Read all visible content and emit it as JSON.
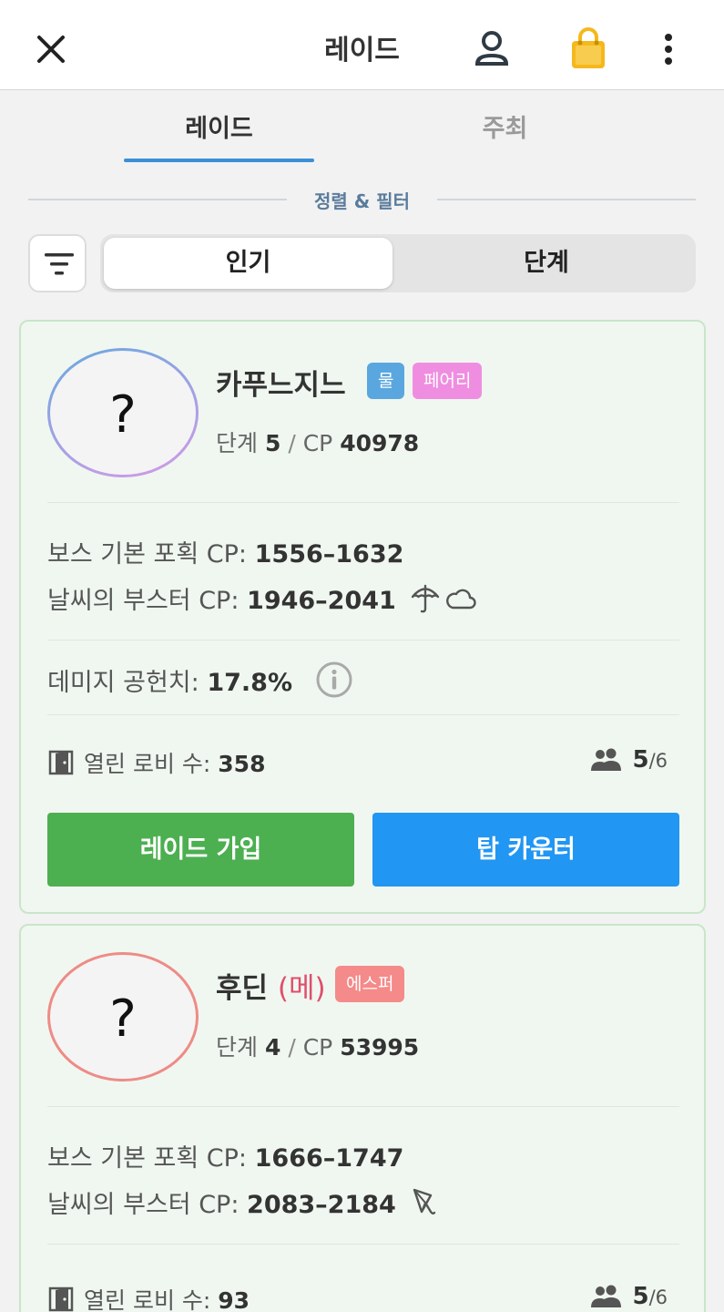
{
  "header": {
    "title": "레이드"
  },
  "tabs": [
    {
      "label": "레이드"
    },
    {
      "label": "주최"
    }
  ],
  "section_label": "정렬 & 필터",
  "sort": {
    "options": [
      "인기",
      "단계"
    ],
    "selected": "인기"
  },
  "raids": [
    {
      "name": "카푸느지느",
      "form": "",
      "types": [
        "물",
        "페어리"
      ],
      "tier_label": "단계",
      "tier": "5",
      "cp_label": "CP",
      "cp": "40978",
      "base_cp_label": "보스 기본 포획 CP:",
      "base_cp": "1556–1632",
      "boosted_cp_label": "날씨의 부스터 CP:",
      "boosted_cp": "1946–2041",
      "weather_icons": [
        "umbrella-icon",
        "cloud-icon"
      ],
      "damage_label": "데미지 공헌치:",
      "damage": "17.8%",
      "lobby_label": "열린 로비 수:",
      "lobbies": "358",
      "party_current": "5",
      "party_total": "/6",
      "join_label": "레이드 가입",
      "counter_label": "탑 카운터"
    },
    {
      "name": "후딘",
      "form": "(메)",
      "types": [
        "에스퍼"
      ],
      "tier_label": "단계",
      "tier": "4",
      "cp_label": "CP",
      "cp": "53995",
      "base_cp_label": "보스 기본 포획 CP:",
      "base_cp": "1666–1747",
      "boosted_cp_label": "날씨의 부스터 CP:",
      "boosted_cp": "2083–2184",
      "weather_icons": [
        "windy-icon"
      ],
      "lobby_label": "열린 로비 수:",
      "lobbies": "93",
      "party_current": "5",
      "party_total": "/6"
    }
  ],
  "colors": {
    "tab_underline": "#3b8fd6",
    "join_button": "#4caf50",
    "counter_button": "#2196f3",
    "card_bg": "#f0f7f0",
    "bag_icon": "#f5b81c"
  }
}
